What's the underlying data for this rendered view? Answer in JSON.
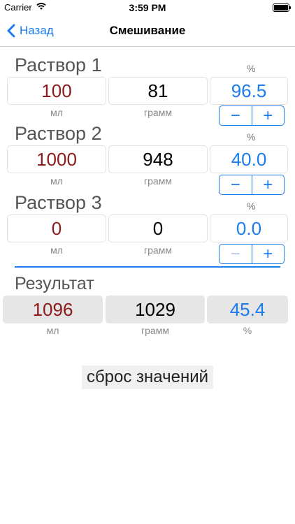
{
  "status": {
    "carrier": "Carrier",
    "time": "3:59 PM"
  },
  "nav": {
    "back_label": "Назад",
    "title": "Смешивание"
  },
  "solutions": [
    {
      "title": "Раствор 1",
      "ml": "100",
      "gram": "81",
      "percent": "96.5",
      "percent_unit": "%",
      "ml_unit": "мл",
      "gram_unit": "грамм",
      "minus": "−",
      "plus": "+"
    },
    {
      "title": "Раствор 2",
      "ml": "1000",
      "gram": "948",
      "percent": "40.0",
      "percent_unit": "%",
      "ml_unit": "мл",
      "gram_unit": "грамм",
      "minus": "−",
      "plus": "+"
    },
    {
      "title": "Раствор 3",
      "ml": "0",
      "gram": "0",
      "percent": "0.0",
      "percent_unit": "%",
      "ml_unit": "мл",
      "gram_unit": "грамм",
      "minus": "−",
      "plus": "+"
    }
  ],
  "result": {
    "title": "Результат",
    "ml": "1096",
    "gram": "1029",
    "percent": "45.4",
    "ml_unit": "мл",
    "gram_unit": "грамм",
    "percent_unit": "%"
  },
  "reset_label": "сброс значений",
  "colors": {
    "accent": "#1a7cf0",
    "ml_value": "#8b1a1a"
  }
}
